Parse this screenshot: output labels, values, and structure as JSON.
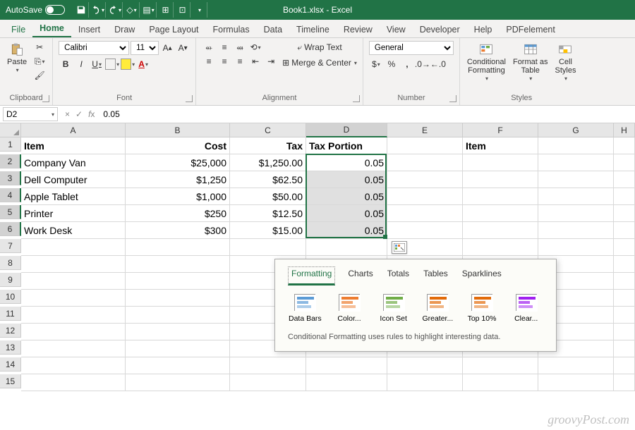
{
  "title": "Book1.xlsx - Excel",
  "autosave_label": "AutoSave",
  "menu": [
    "File",
    "Home",
    "Insert",
    "Draw",
    "Page Layout",
    "Formulas",
    "Data",
    "Timeline",
    "Review",
    "View",
    "Developer",
    "Help",
    "PDFelement"
  ],
  "menu_active": "Home",
  "ribbon": {
    "clipboard": {
      "label": "Clipboard",
      "paste": "Paste"
    },
    "font": {
      "label": "Font",
      "family": "Calibri",
      "size": "11"
    },
    "alignment": {
      "label": "Alignment",
      "wrap": "Wrap Text",
      "merge": "Merge & Center"
    },
    "number": {
      "label": "Number",
      "format": "General"
    },
    "styles": {
      "label": "Styles",
      "cond": "Conditional\nFormatting",
      "table": "Format as\nTable",
      "cell": "Cell\nStyles"
    }
  },
  "namebox": "D2",
  "formula": "0.05",
  "columns": [
    "A",
    "B",
    "C",
    "D",
    "E",
    "F",
    "G",
    "H"
  ],
  "selected_col": "D",
  "rows": 15,
  "selected_rows": [
    2,
    3,
    4,
    5,
    6
  ],
  "data": {
    "r1": {
      "A": "Item",
      "B": "Cost",
      "C": "Tax",
      "D": "Tax Portion",
      "F": "Item"
    },
    "r2": {
      "A": "Company Van",
      "B": "$25,000",
      "C": "$1,250.00",
      "D": "0.05"
    },
    "r3": {
      "A": "Dell Computer",
      "B": "$1,250",
      "C": "$62.50",
      "D": "0.05"
    },
    "r4": {
      "A": "Apple Tablet",
      "B": "$1,000",
      "C": "$50.00",
      "D": "0.05"
    },
    "r5": {
      "A": "Printer",
      "B": "$250",
      "C": "$12.50",
      "D": "0.05"
    },
    "r6": {
      "A": "Work Desk",
      "B": "$300",
      "C": "$15.00",
      "D": "0.05"
    }
  },
  "qa": {
    "tabs": [
      "Formatting",
      "Charts",
      "Totals",
      "Tables",
      "Sparklines"
    ],
    "active": "Formatting",
    "items": [
      "Data Bars",
      "Color...",
      "Icon Set",
      "Greater...",
      "Top 10%",
      "Clear..."
    ],
    "desc": "Conditional Formatting uses rules to highlight interesting data."
  },
  "watermark": "groovyPost.com"
}
